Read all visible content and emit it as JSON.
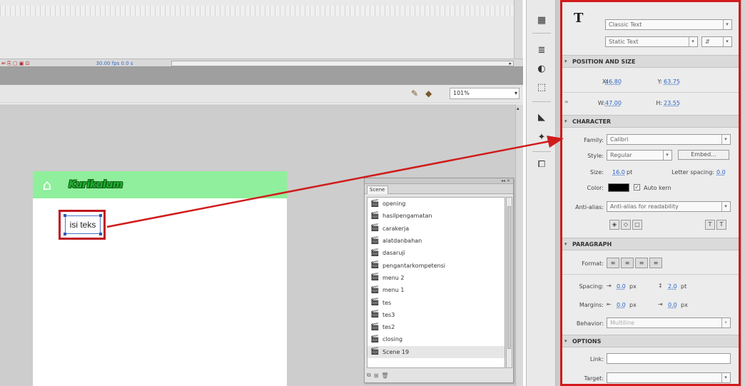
{
  "timeline": {
    "tools": "⇚ ⎘ ▢ ▣ ⊡",
    "frame_info": "30.00 fps  0.0 s"
  },
  "stage_toolbar": {
    "zoom": "101%"
  },
  "stage": {
    "header_title": "Kurikulum",
    "text_box": "isi teks"
  },
  "scene_panel": {
    "tab": "Scene",
    "scenes": [
      "opening",
      "hasilpengamatan",
      "carakerja",
      "alatdanbahan",
      "dasaruji",
      "pengantarkompetensi",
      "menu 2",
      "menu 1",
      "tes",
      "tes3",
      "tes2",
      "closing",
      "Scene 19"
    ]
  },
  "properties": {
    "text_engine": "Classic Text",
    "text_type": "Static Text",
    "position_size": {
      "title": "POSITION AND SIZE",
      "x_label": "X:",
      "x": "46.80",
      "y_label": "Y:",
      "y": "63.75",
      "w_label": "W:",
      "w": "47.00",
      "h_label": "H:",
      "h": "23.55"
    },
    "character": {
      "title": "CHARACTER",
      "family_label": "Family:",
      "family": "Calibri",
      "style_label": "Style:",
      "style": "Regular",
      "embed_button": "Embed...",
      "size_label": "Size:",
      "size": "16.0",
      "size_unit": "pt",
      "letter_spacing_label": "Letter spacing:",
      "letter_spacing": "0.0",
      "color_label": "Color:",
      "color": "#000000",
      "autokern_label": "Auto kern",
      "antialias_label": "Anti-alias:",
      "antialias": "Anti-alias for readability"
    },
    "paragraph": {
      "title": "PARAGRAPH",
      "format_label": "Format:",
      "spacing_label": "Spacing:",
      "spacing_indent": "0.0",
      "spacing_indent_unit": "px",
      "spacing_line": "2.0",
      "spacing_line_unit": "pt",
      "margins_label": "Margins:",
      "margin_left": "0.0",
      "margin_left_unit": "px",
      "margin_right": "0.0",
      "margin_right_unit": "px",
      "behavior_label": "Behavior:",
      "behavior": "Multiline"
    },
    "options": {
      "title": "OPTIONS",
      "link_label": "Link:",
      "link": "",
      "target_label": "Target:",
      "target": ""
    }
  },
  "colors": {
    "highlight_red": "#d11b1b",
    "stage_header_green": "#8fef9c",
    "title_green": "#1cb02c"
  }
}
